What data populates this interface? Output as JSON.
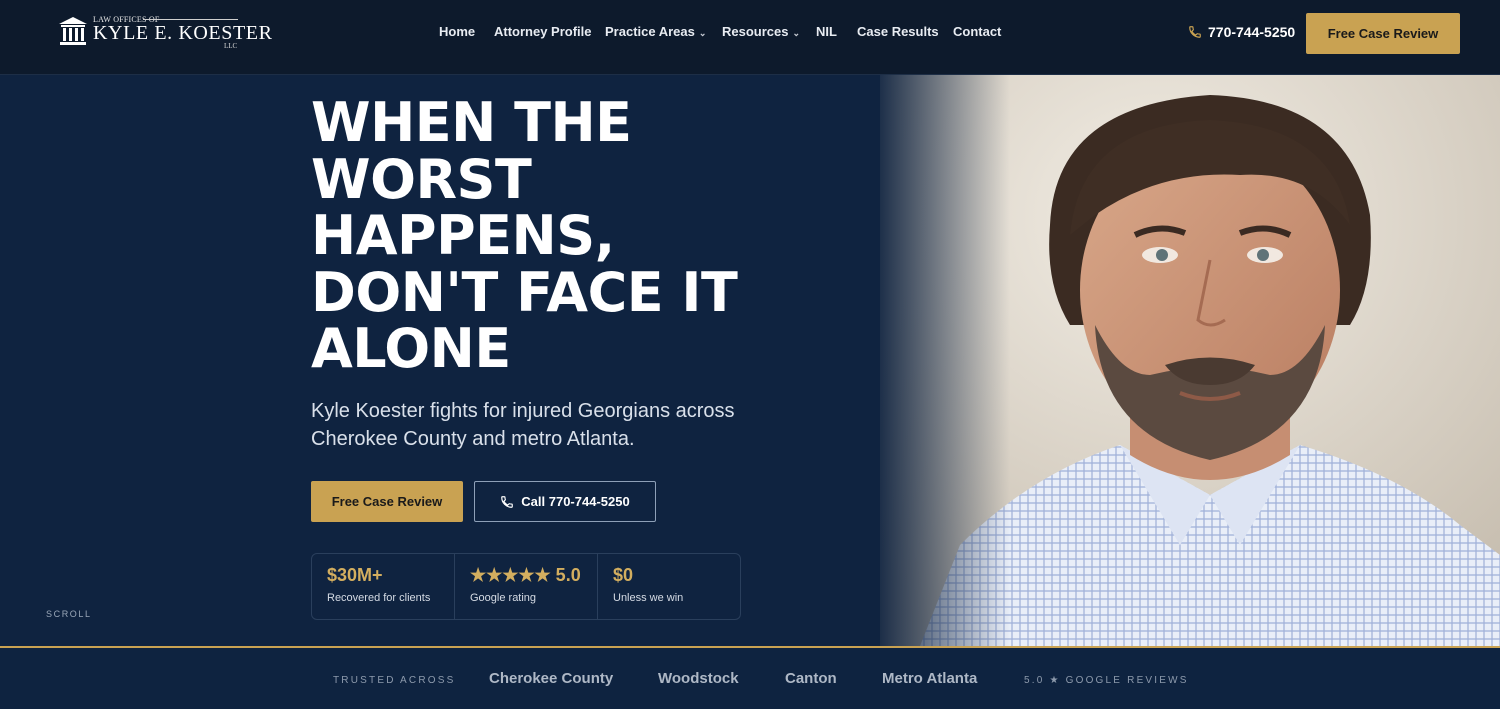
{
  "logo": {
    "top_line": "LAW OFFICES OF",
    "name": "KYLE E. KOESTER",
    "suffix": "LLC"
  },
  "nav": {
    "items": [
      {
        "label": "Home",
        "has_dropdown": false
      },
      {
        "label": "Attorney Profile",
        "has_dropdown": false
      },
      {
        "label": "Practice Areas",
        "has_dropdown": true
      },
      {
        "label": "Resources",
        "has_dropdown": true
      },
      {
        "label": "NIL",
        "has_dropdown": false
      },
      {
        "label": "Case Results",
        "has_dropdown": false
      },
      {
        "label": "Contact",
        "has_dropdown": false
      }
    ],
    "caret": "⌄"
  },
  "header": {
    "phone": "770-744-5250",
    "cta_label": "Free Case Review"
  },
  "hero": {
    "headline_lines": [
      "WHEN THE",
      "WORST",
      "HAPPENS,",
      "DON'T FACE IT",
      "ALONE"
    ],
    "subtext": "Kyle Koester fights for injured Georgians across Cherokee County and metro Atlanta.",
    "primary_button": "Free Case Review",
    "secondary_button": "Call 770-744-5250",
    "stats": [
      {
        "value": "$30M+",
        "label": "Recovered for clients"
      },
      {
        "value": "★★★★★ 5.0",
        "label": "Google rating"
      },
      {
        "value": "$0",
        "label": "Unless we win"
      }
    ],
    "scroll_label": "SCROLL"
  },
  "trust_bar": {
    "label": "TRUSTED ACROSS",
    "places": [
      "Cherokee County",
      "Woodstock",
      "Canton",
      "Metro Atlanta"
    ],
    "reviews": "5.0 ★ GOOGLE REVIEWS"
  },
  "colors": {
    "navy": "#0f2340",
    "header_bg": "#0d1a2c",
    "gold": "#c9a252",
    "stat_gold": "#d3ae5f"
  },
  "icons": {
    "logo": "courthouse-pillars-icon",
    "phone": "phone-icon",
    "dropdown": "chevron-down-icon"
  }
}
